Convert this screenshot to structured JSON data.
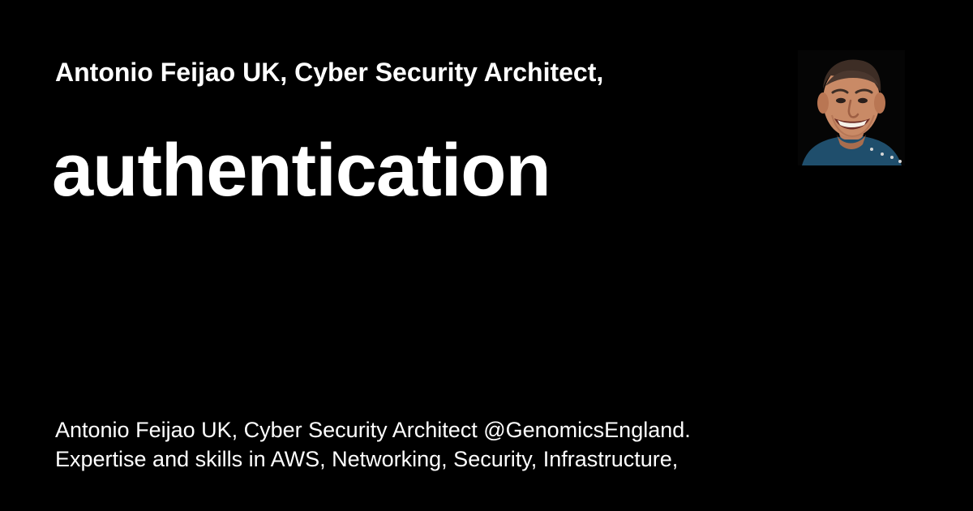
{
  "header": {
    "site_title": "Antonio Feijao UK, Cyber Security Architect,"
  },
  "main": {
    "page_title": "authentication"
  },
  "footer": {
    "description_lines": [
      "Antonio Feijao UK, Cyber Security Architect @GenomicsEngland.",
      "Expertise and skills in AWS, Networking, Security, Infrastructure,"
    ]
  },
  "avatar": {
    "icon": "author-avatar-icon"
  },
  "colors": {
    "background": "#000000",
    "text": "#ffffff",
    "shirt": "#1f4e6c"
  }
}
